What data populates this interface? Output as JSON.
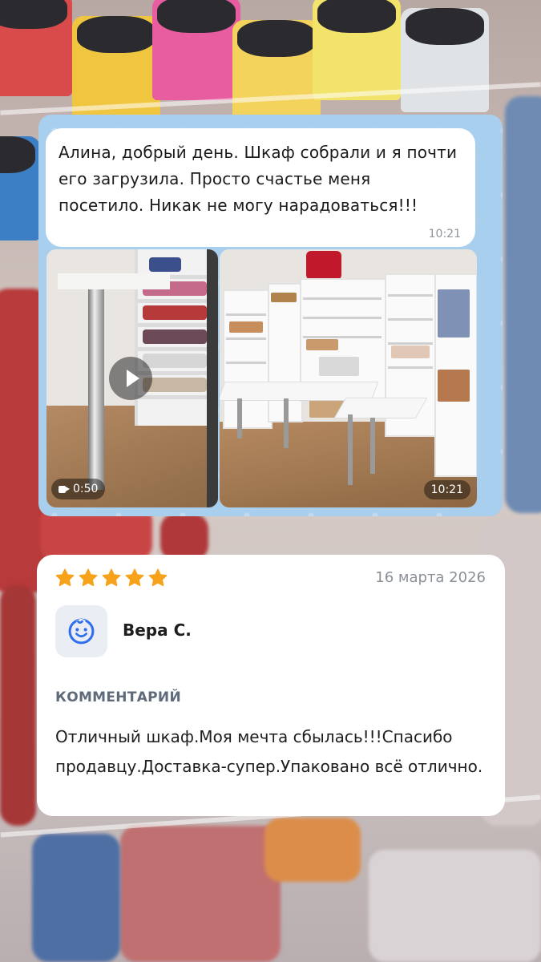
{
  "chat": {
    "message_text": "Алина, добрый день. Шкаф собрали и я почти его загрузила. Просто счастье меня посетило. Никак не могу  нарадоваться!!!",
    "message_time": "10:21",
    "video_duration": "0:50",
    "photo_time": "10:21",
    "background_color": "#a9cfee"
  },
  "review": {
    "rating": 5,
    "rating_max": 5,
    "date": "16 марта 2026",
    "author": "Вера С.",
    "avatar_icon": "baby-face-icon",
    "section_label": "КОММЕНТАРИЙ",
    "text": "Отличный шкаф.Моя мечта сбылась!!!Спасибо продавцу.Доставка-супер.Упаковано всё отлично."
  },
  "colors": {
    "star": "#f7a21b",
    "accent_blue": "#2f6fed"
  }
}
